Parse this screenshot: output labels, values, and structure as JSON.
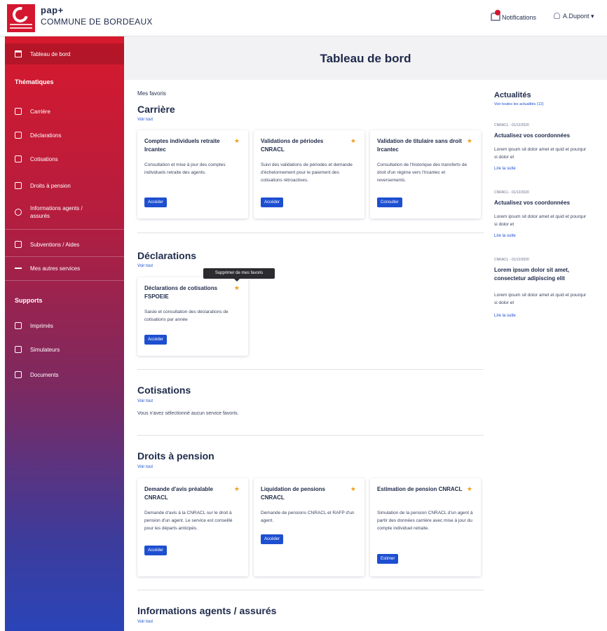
{
  "header": {
    "brand_small": "pap+",
    "brand_main": "COMMUNE DE BORDEAUX",
    "notifications_label": "Notifications",
    "user_label": "A.Dupont ▾"
  },
  "sidebar": {
    "dashboard": "Tableau de bord",
    "thematiques_heading": "Thématiques",
    "items": [
      "Carrière",
      "Déclarations",
      "Cotisations",
      "Droits à pension",
      "Informations agents / assurés",
      "Subventions / Aides",
      "Mes autres services"
    ],
    "supports_heading": "Supports",
    "supports": [
      "Imprimés",
      "Simulateurs",
      "Documents"
    ]
  },
  "page_title": "Tableau de bord",
  "favorites_label": "Mes favoris",
  "see_all": "Voir tout",
  "sections": {
    "carriere": {
      "title": "Carrière",
      "cards": [
        {
          "title": "Comptes individuels retraite Ircantec",
          "desc": "Consultation et mise à jour des comptes individuels retraite des agents.",
          "button": "Accéder"
        },
        {
          "title": "Validations de périodes CNRACL",
          "desc": "Suivi des validations de périodes et demande d'échelonnement pour le paiement des cotisations rétroactives.",
          "button": "Accéder"
        },
        {
          "title": "Validation de titulaire sans droit Ircantec",
          "desc": "Consultation de l'historique des transferts de droit d'un régime vers l'Ircantec et reversements.",
          "button": "Consulter"
        }
      ]
    },
    "declarations": {
      "title": "Déclarations",
      "cards": [
        {
          "title": "Déclarations de cotisations FSPOEIE",
          "desc": "Saisie et consultation des déclarations de cotisations par année",
          "button": "Accéder"
        }
      ],
      "tooltip": "Supprimer de mes favoris"
    },
    "cotisations": {
      "title": "Cotisations",
      "empty": "Vous n'avez sélectionné aucun service favoris."
    },
    "droits": {
      "title": "Droits à pension",
      "cards": [
        {
          "title": "Demande d'avis préalable CNRACL",
          "desc": "Demande d'avis à la CNRACL sur le droit à pension d'un agent. Le service est conseillé pour les départs anticipés.",
          "button": "Accéder"
        },
        {
          "title": "Liquidation de pensions CNRACL",
          "desc": "Demande de pensions CNRACL et RAFP d'un agent.",
          "button": "Accéder"
        },
        {
          "title": "Estimation de pension CNRACL",
          "desc": "Simulation de la pension CNRACL d'un agent à partir des données carrière avec mise à jour du compte individuel retraite.",
          "button": "Estimer"
        }
      ]
    },
    "informations": {
      "title": "Informations agents / assurés"
    }
  },
  "news": {
    "title": "Actualités",
    "see_all": "Voir toutes les actualités (12)",
    "items": [
      {
        "date": "CNRACL - 01/12/2020",
        "headline": "Actualisez vos coordonnées",
        "body": "Lorem ipsum sit dolor amet et quid et pourqur si dolor et",
        "link": "Lire la suite"
      },
      {
        "date": "CNRACL - 01/12/2020",
        "headline": "Actualisez vos coordonnées",
        "body": "Lorem ipsum sit dolor amet et quid et pourqur si dolor et",
        "link": "Lire la suite"
      },
      {
        "date": "CNRACL - 01/12/2020",
        "headline": "Lorem ipsum dolor sit amet, consectetur adipiscing elit",
        "body": "Lorem ipsum sit dolor amet et quid et pourqur si dolor et",
        "link": "Lire la suite"
      }
    ]
  },
  "colors": {
    "brand_red": "#d4162f",
    "primary_blue": "#1d4fd1",
    "navy_text": "#1e2a4a",
    "favorite_star": "#f0a020"
  },
  "icons": {
    "favorite": "★"
  }
}
